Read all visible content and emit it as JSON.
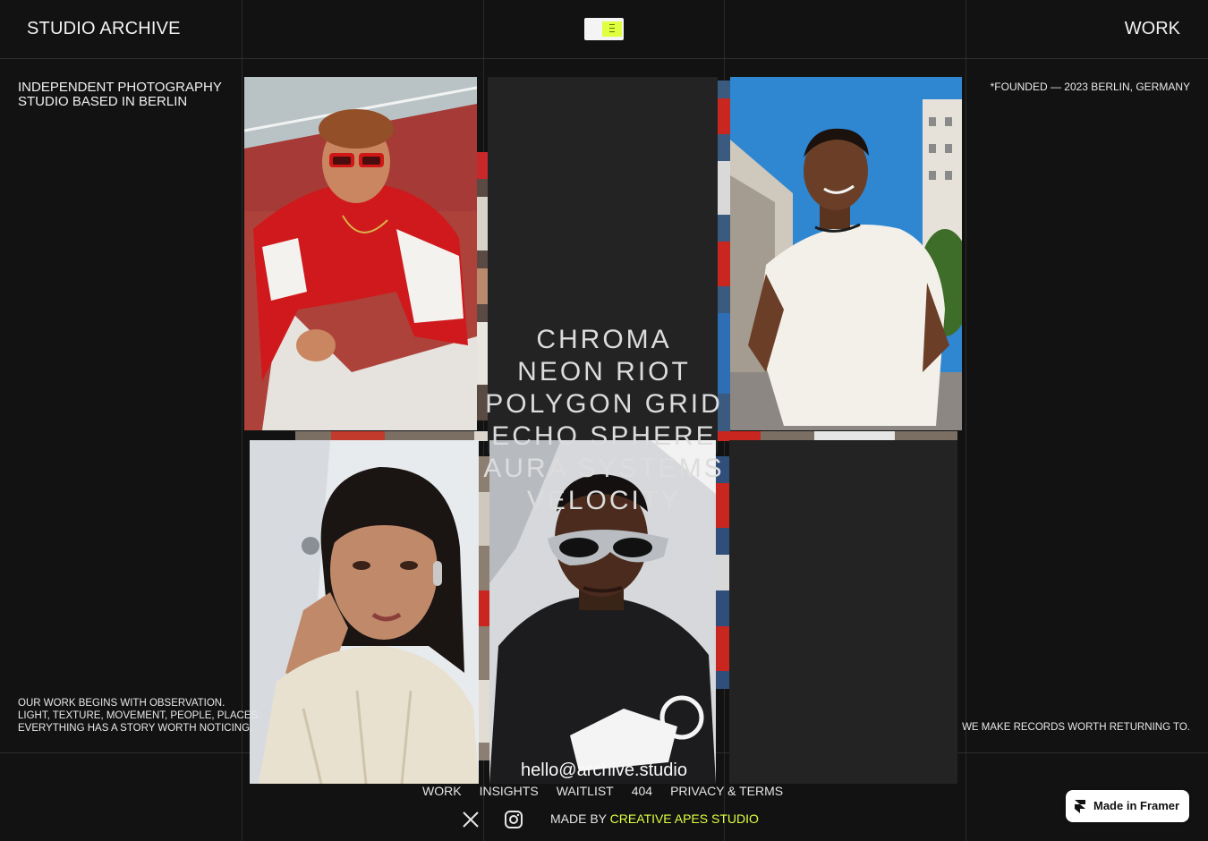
{
  "header": {
    "brand": "STUDIO ARCHIVE",
    "nav_work": "WORK",
    "menu_icon": "menu-icon"
  },
  "intro": {
    "tagline_line1": "INDEPENDENT PHOTOGRAPHY",
    "tagline_line2": "STUDIO BASED IN BERLIN",
    "founded": "*FOUNDED — 2023 BERLIN, GERMANY"
  },
  "projects": [
    "CHROMA",
    "NEON RIOT",
    "POLYGON GRID",
    "ECHO SPHERE",
    "AURA SYSTEMS",
    "VELOCITY"
  ],
  "statement": {
    "line1": "OUR WORK BEGINS WITH OBSERVATION.",
    "line2": "LIGHT, TEXTURE, MOVEMENT, PEOPLE, PLACES.",
    "line3": "EVERYTHING HAS A STORY WORTH NOTICING.",
    "right": "WE MAKE RECORDS WORTH RETURNING TO."
  },
  "footer": {
    "email": "hello@archive.studio",
    "nav": [
      "WORK",
      "INSIGHTS",
      "WAITLIST",
      "404",
      "PRIVACY & TERMS"
    ],
    "social": [
      "x-icon",
      "instagram-icon"
    ],
    "made_by_prefix": "MADE BY ",
    "made_by_name": "CREATIVE APES STUDIO"
  },
  "badge": {
    "label": "Made in Framer",
    "icon": "framer-icon"
  },
  "colors": {
    "background": "#121212",
    "accent": "#dfff3f",
    "panel": "#232323"
  }
}
